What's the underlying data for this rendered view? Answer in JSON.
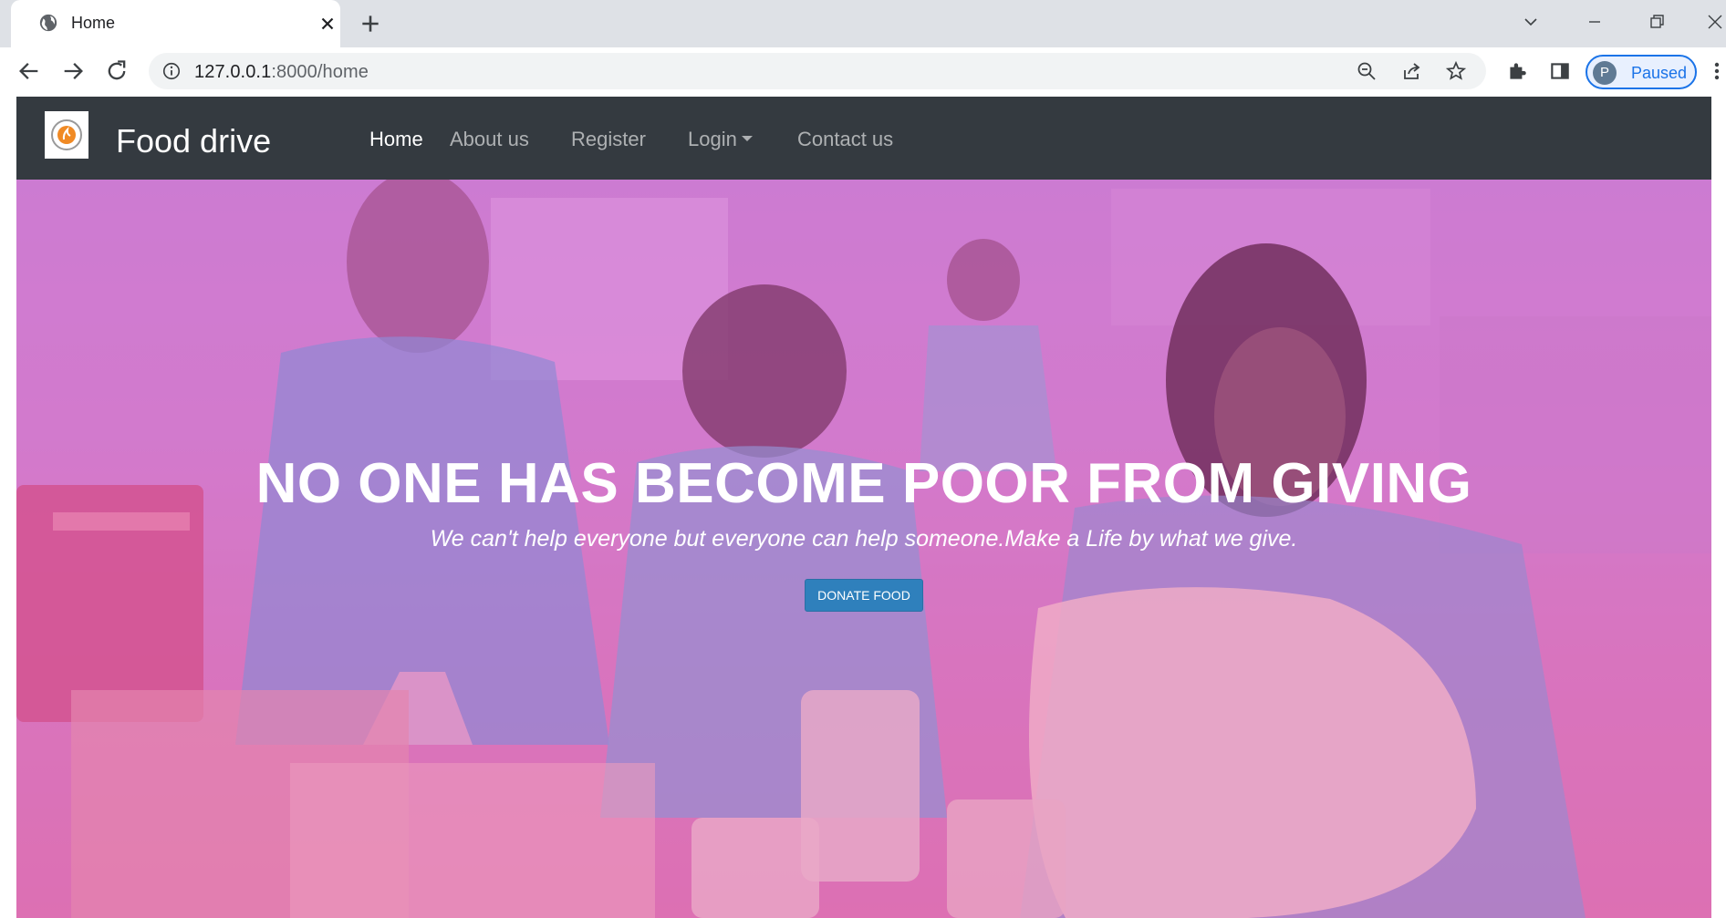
{
  "browser": {
    "tab_title": "Home",
    "url_host": "127.0.0.1",
    "url_rest": ":8000/home",
    "profile_initial": "P",
    "profile_status": "Paused"
  },
  "navbar": {
    "brand": "Food drive",
    "links": [
      "Home",
      "About us",
      "Register",
      "Login",
      "Contact us"
    ],
    "active": "Home"
  },
  "hero": {
    "title": "NO ONE HAS BECOME POOR FROM GIVING",
    "subtitle": "We can't help everyone but everyone can help someone.Make a Life by what we give.",
    "button": "DONATE FOOD"
  },
  "colors": {
    "navbar_bg": "#343a40",
    "button_bg": "#2f80bc",
    "profile_accent": "#1a73e8"
  }
}
